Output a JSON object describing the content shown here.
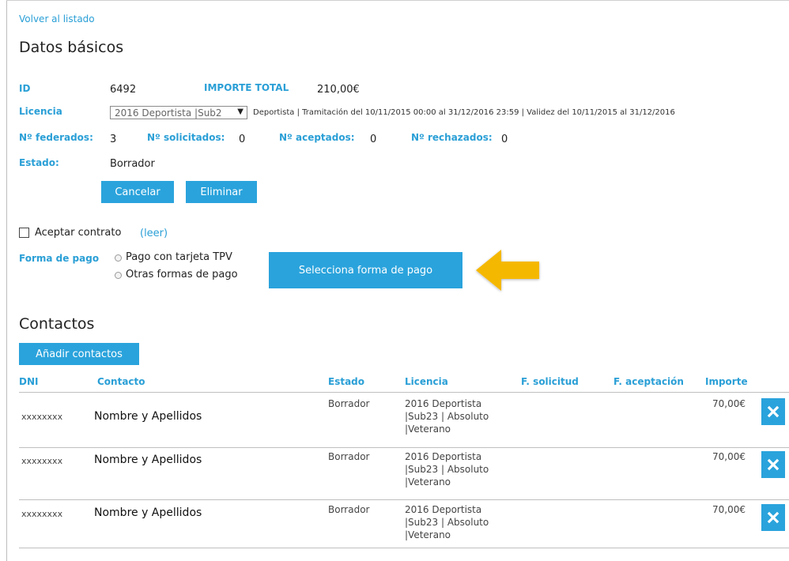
{
  "nav": {
    "back_link": "Volver al listado"
  },
  "page_title": "Datos básicos",
  "fields": {
    "id_label": "ID",
    "id_value": "6492",
    "importe_label": "IMPORTE TOTAL",
    "importe_value": "210,00€",
    "licencia_label": "Licencia",
    "licencia_selected": "2016 Deportista |Sub2",
    "licencia_info": "Deportista | Tramitación del 10/11/2015 00:00 al 31/12/2016 23:59 | Validez del 10/11/2015 al 31/12/2016",
    "federados_label": "Nº federados:",
    "federados_value": "3",
    "solicitados_label": "Nº solicitados:",
    "solicitados_value": "0",
    "aceptados_label": "Nº aceptados:",
    "aceptados_value": "0",
    "rechazados_label": "Nº rechazados:",
    "rechazados_value": "0",
    "estado_label": "Estado:",
    "estado_value": "Borrador"
  },
  "actions": {
    "cancel_label": "Cancelar",
    "delete_label": "Eliminar"
  },
  "contract": {
    "accept_label": "Aceptar contrato",
    "read_link": "(leer)"
  },
  "payment": {
    "label": "Forma de pago",
    "option_tpv": "Pago con tarjeta TPV",
    "option_other": "Otras formas de pago",
    "select_button": "Selecciona forma de pago",
    "arrow_color": "#f5b800"
  },
  "contacts": {
    "title": "Contactos",
    "add_button": "Añadir contactos",
    "columns": [
      "DNI",
      "Contacto",
      "Estado",
      "Licencia",
      "F. solicitud",
      "F. aceptación",
      "Importe"
    ],
    "rows": [
      {
        "dni": "xxxxxxxx",
        "contacto": "Nombre y Apellidos",
        "estado": "Borrador",
        "licencia": "2016 Deportista |Sub23 | Absoluto |Veterano",
        "f_solicitud": "",
        "f_aceptacion": "",
        "importe": "70,00€"
      },
      {
        "dni": "xxxxxxxx",
        "contacto": "Nombre y Apellidos",
        "estado": "Borrador",
        "licencia": "2016 Deportista |Sub23 | Absoluto |Veterano",
        "f_solicitud": "",
        "f_aceptacion": "",
        "importe": "70,00€"
      },
      {
        "dni": "xxxxxxxx",
        "contacto": "Nombre y Apellidos",
        "estado": "Borrador",
        "licencia": "2016 Deportista |Sub23 | Absoluto |Veterano",
        "f_solicitud": "",
        "f_aceptacion": "",
        "importe": "70,00€"
      }
    ]
  },
  "colors": {
    "accent": "#2aa3dc",
    "label_blue": "#2a9fd6"
  }
}
